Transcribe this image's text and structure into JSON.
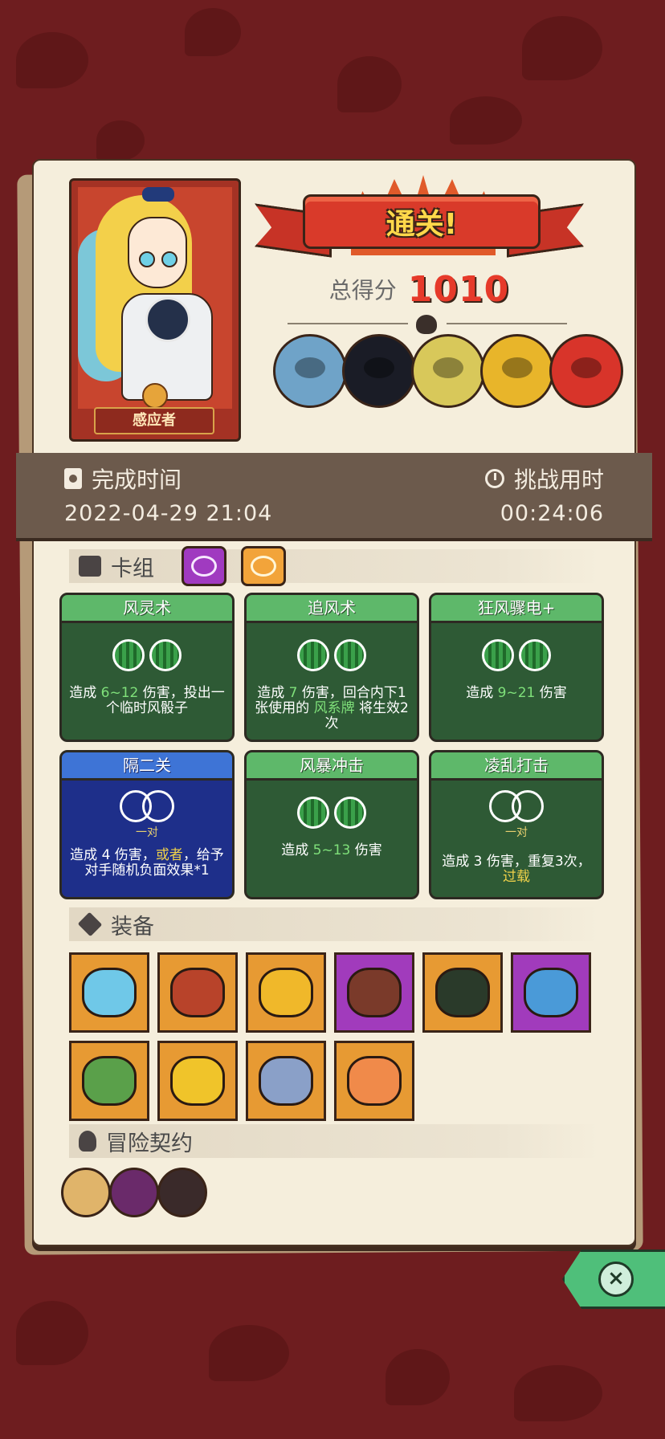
{
  "character": {
    "name": "感应者"
  },
  "result": {
    "banner": "通关!",
    "score_label": "总得分",
    "score_value": "1010"
  },
  "bosses": [
    {
      "color": "#6fa3c8"
    },
    {
      "color": "#1a1c26"
    },
    {
      "color": "#d8c85a"
    },
    {
      "color": "#e8b52a"
    },
    {
      "color": "#d8342a"
    }
  ],
  "time": {
    "finish_label": "完成时间",
    "finish_value": "2022-04-29 21:04",
    "duration_label": "挑战用时",
    "duration_value": "00:24:06"
  },
  "sections": {
    "deck": "卡组",
    "equipment": "装备",
    "contract": "冒险契约"
  },
  "cards": [
    {
      "title": "风灵术",
      "desc": [
        "造成 ",
        "6~12",
        " 伤害，投出一个临时风骰子"
      ]
    },
    {
      "title": "追风术",
      "desc": [
        "造成 ",
        "7",
        " 伤害，回合内下1张使用的 ",
        "风系牌",
        " 将生效2次"
      ]
    },
    {
      "title": "狂风骤电+",
      "desc": [
        "造成 ",
        "9~21",
        " 伤害"
      ]
    },
    {
      "title": "隔二关",
      "pair": "一对",
      "desc": [
        "造成 ",
        "4",
        " 伤害，",
        "或者",
        "，给予对手随机负面效果*1"
      ]
    },
    {
      "title": "风暴冲击",
      "desc": [
        "造成 ",
        "5~13",
        " 伤害"
      ]
    },
    {
      "title": "凌乱打击",
      "pair": "一对",
      "desc": [
        "造成 ",
        "3",
        " 伤害，重复3次，",
        "过载"
      ]
    }
  ],
  "equipment": [
    {
      "name": "ghost-jelly",
      "bg": "orange",
      "color": "#6fc8e8"
    },
    {
      "name": "red-hood",
      "bg": "orange",
      "color": "#b8432a"
    },
    {
      "name": "flame-crown",
      "bg": "orange",
      "color": "#f0b82a"
    },
    {
      "name": "fire-book",
      "bg": "purple",
      "color": "#7a3a2a"
    },
    {
      "name": "dark-horn",
      "bg": "orange",
      "color": "#2a3a2a"
    },
    {
      "name": "blue-shield",
      "bg": "purple",
      "color": "#4a9ad8"
    },
    {
      "name": "green-scroll",
      "bg": "orange",
      "color": "#5aa04a"
    },
    {
      "name": "gold-coin",
      "bg": "orange",
      "color": "#f0c42a"
    },
    {
      "name": "horn-cannon",
      "bg": "orange",
      "color": "#8aa0c8"
    },
    {
      "name": "eye-shield",
      "bg": "orange",
      "color": "#f08a4a"
    }
  ],
  "contracts": [
    {
      "name": "scroll",
      "color": "#e0b46a"
    },
    {
      "name": "fist-seal",
      "color": "#6a2a6a"
    },
    {
      "name": "flower-pot",
      "color": "#3a2a2a"
    }
  ]
}
